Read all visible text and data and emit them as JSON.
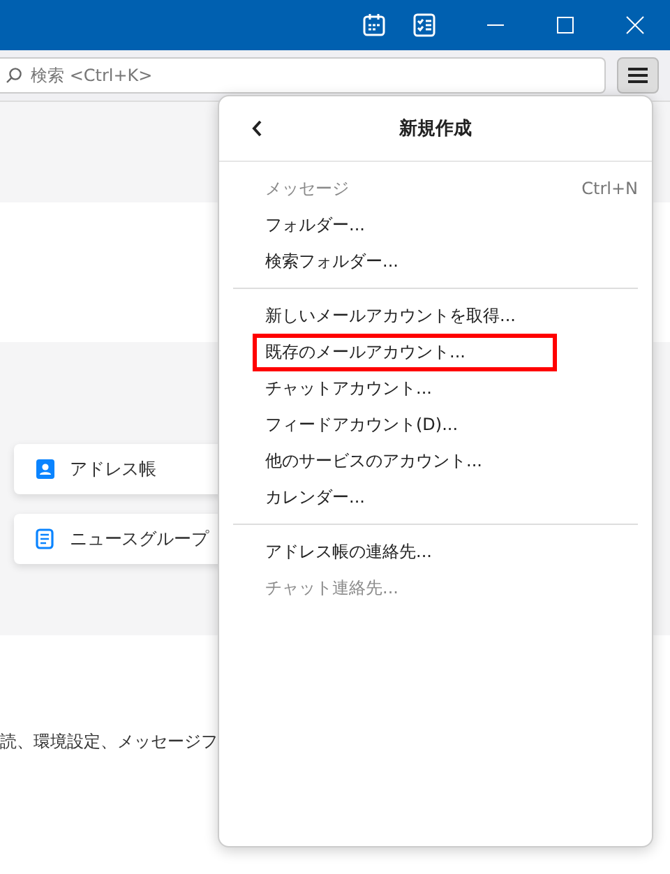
{
  "toolbar": {
    "search": {
      "placeholder": "検索 <Ctrl+K>"
    }
  },
  "cards": [
    {
      "label": "アドレス帳",
      "kind": "addressbook"
    },
    {
      "label": "ニュースグループ",
      "kind": "newsgroup"
    }
  ],
  "footer_text": "読、環境設定、メッセージフ",
  "menu": {
    "title": "新規作成",
    "groups": [
      [
        {
          "label": "メッセージ",
          "shortcut": "Ctrl+N",
          "disabled": true,
          "highlighted": false
        },
        {
          "label": "フォルダー...",
          "disabled": false,
          "highlighted": false
        },
        {
          "label": "検索フォルダー...",
          "disabled": false,
          "highlighted": false
        }
      ],
      [
        {
          "label": "新しいメールアカウントを取得...",
          "disabled": false,
          "highlighted": false
        },
        {
          "label": "既存のメールアカウント...",
          "disabled": false,
          "highlighted": true
        },
        {
          "label": "チャットアカウント...",
          "disabled": false,
          "highlighted": false
        },
        {
          "label": "フィードアカウント(D)...",
          "disabled": false,
          "highlighted": false
        },
        {
          "label": "他のサービスのアカウント...",
          "disabled": false,
          "highlighted": false
        },
        {
          "label": "カレンダー...",
          "disabled": false,
          "highlighted": false
        }
      ],
      [
        {
          "label": "アドレス帳の連絡先...",
          "disabled": false,
          "highlighted": false
        },
        {
          "label": "チャット連絡先...",
          "disabled": true,
          "highlighted": false
        }
      ]
    ]
  }
}
